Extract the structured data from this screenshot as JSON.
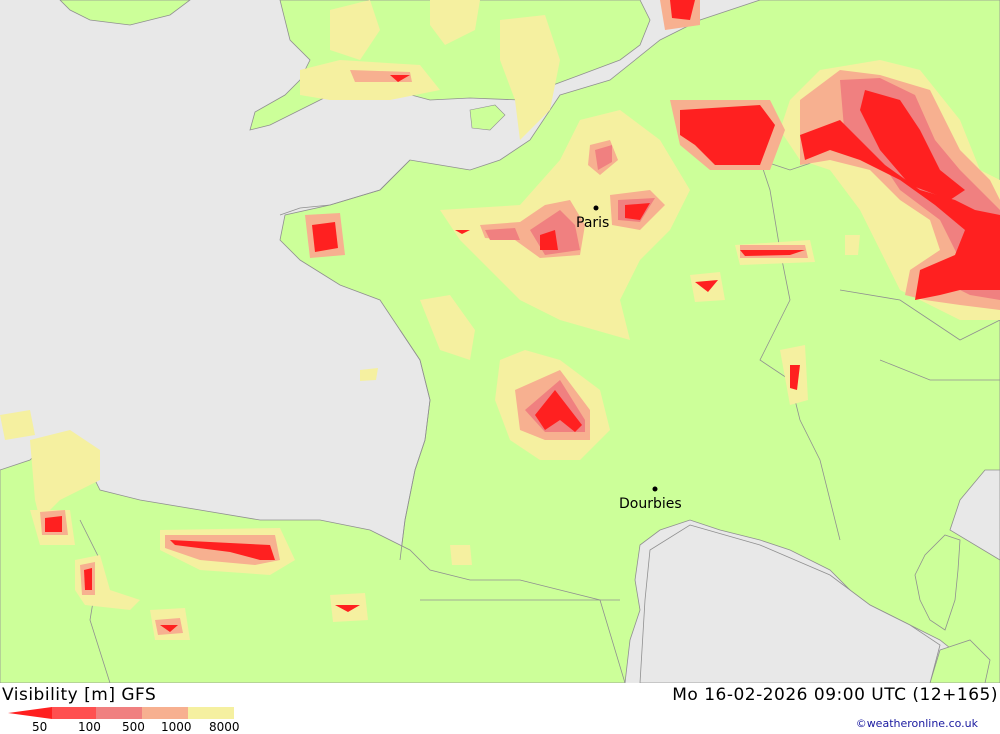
{
  "map": {
    "cities": [
      {
        "name": "Paris"
      },
      {
        "name": "Dourbies"
      }
    ],
    "colors": {
      "sea": "#e8e8e8",
      "land": "#ccff99",
      "vis_8000": "#f5f0a0",
      "vis_1000": "#f7b090",
      "vis_500": "#f08080",
      "vis_100": "#ff5050",
      "vis_50": "#ff2020",
      "coast": "#909090"
    }
  },
  "footer": {
    "title": "Visibility [m] GFS",
    "datetime": "Mo 16-02-2026 09:00 UTC (12+165)",
    "credit": "©weatheronline.co.uk",
    "legend": [
      {
        "label": "50",
        "color": "#ff2020"
      },
      {
        "label": "100",
        "color": "#ff5050"
      },
      {
        "label": "500",
        "color": "#f08080"
      },
      {
        "label": "1000",
        "color": "#f7b090"
      },
      {
        "label": "8000",
        "color": "#f5f0a0"
      }
    ]
  }
}
